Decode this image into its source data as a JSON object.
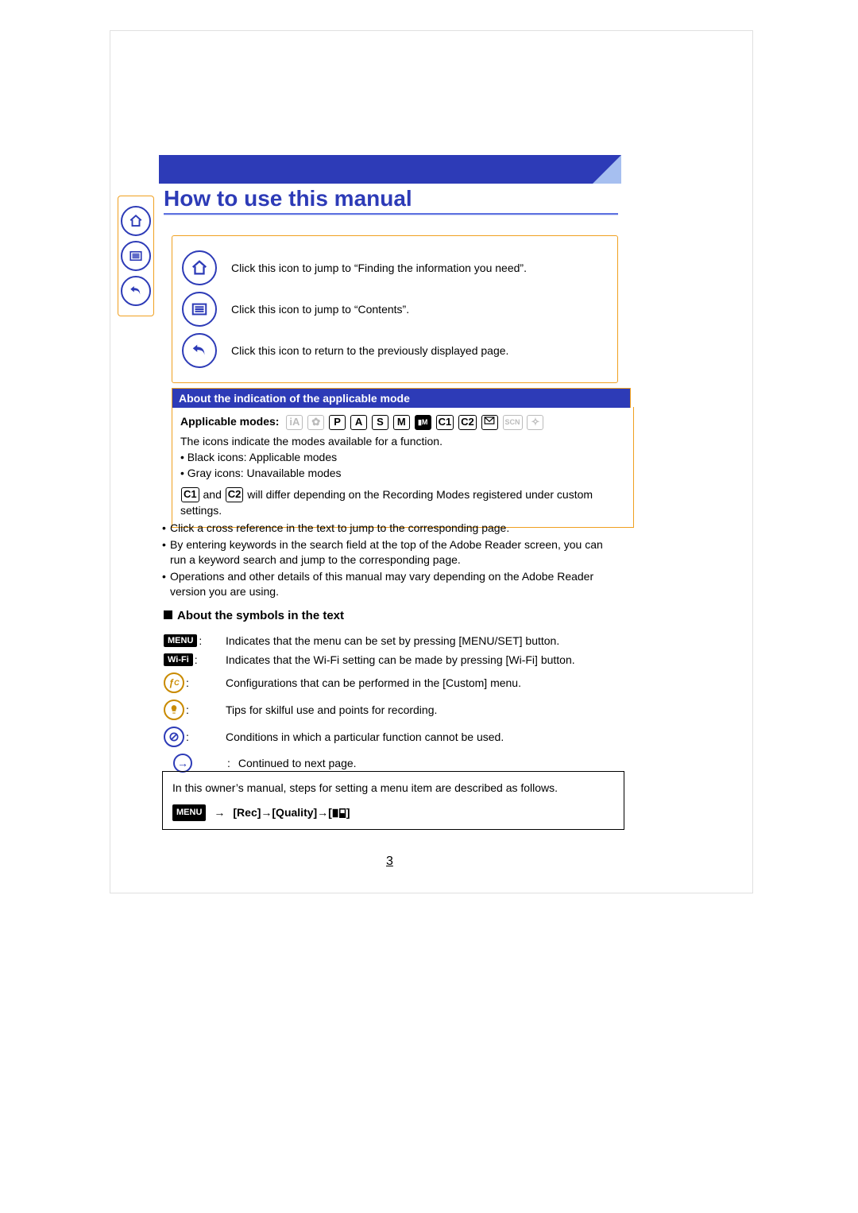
{
  "title": "How to use this manual",
  "nav_icons": {
    "home_desc": "Click this icon to jump to “Finding the information you need”.",
    "contents_desc": "Click this icon to jump to “Contents”.",
    "back_desc": "Click this icon to return to the previously displayed page."
  },
  "modes_section": {
    "header": "About the indication of the applicable mode",
    "label": "Applicable modes:",
    "line1": "The icons indicate the modes available for a function.",
    "bullet_black": "Black icons:  Applicable modes",
    "bullet_gray": "Gray icons:  Unavailable modes",
    "c_note_pre": " and ",
    "c_note_post": " will differ depending on the Recording Modes registered under custom settings."
  },
  "tips": {
    "t1": "Click a cross reference in the text to jump to the corresponding page.",
    "t2": "By entering keywords in the search field at the top of the Adobe Reader screen, you can run a keyword search and jump to the corresponding page.",
    "t3": "Operations and other details of this manual may vary depending on the Adobe Reader version you are using."
  },
  "symbols": {
    "header": "About the symbols in the text",
    "menu_label": "MENU",
    "menu_text": "Indicates that the menu can be set by pressing [MENU/SET] button.",
    "wifi_label": "Wi-Fi",
    "wifi_text": "Indicates that the Wi-Fi setting can be made by pressing [Wi-Fi] button.",
    "custom_text": "Configurations that can be performed in the [Custom] menu.",
    "tips_text": "Tips for skilful use and points for recording.",
    "prohibit_text": "Conditions in which a particular function cannot be used.",
    "next_text": "Continued to next page."
  },
  "footer": {
    "intro": "In this owner’s manual, steps for setting a menu item are described as follows.",
    "menu_label": "MENU",
    "path": "[Rec]→[Quality]→[",
    "path_end": "]"
  },
  "page_number": "3"
}
